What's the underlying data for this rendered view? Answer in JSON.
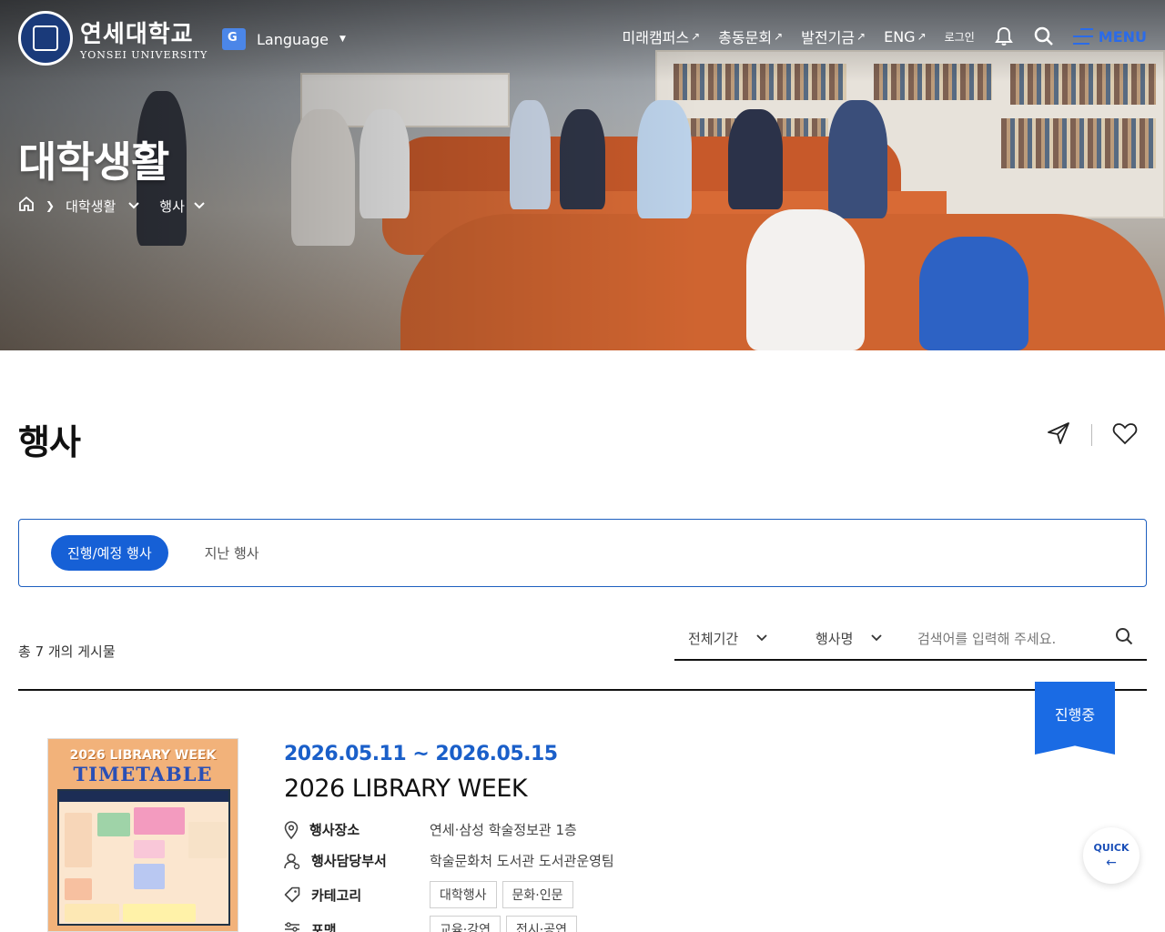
{
  "header": {
    "logo_ko": "연세대학교",
    "logo_en": "YONSEI UNIVERSITY",
    "language_label": "Language",
    "nav": [
      {
        "label": "미래캠퍼스",
        "arrow": "↗"
      },
      {
        "label": "총동문회",
        "arrow": "↗"
      },
      {
        "label": "발전기금",
        "arrow": "↗"
      },
      {
        "label": "ENG",
        "arrow": "↗"
      }
    ],
    "login_label": "로그인",
    "menu_label": "MENU"
  },
  "hero": {
    "title": "대학생활",
    "breadcrumb": [
      "대학생활",
      "행사"
    ]
  },
  "main": {
    "page_title": "행사",
    "tabs": [
      {
        "label": "진행/예정 행사",
        "active": true
      },
      {
        "label": "지난 행사",
        "active": false
      }
    ],
    "count_text": "총 7 개의 게시물",
    "filter_period": "전체기간",
    "filter_kind": "행사명",
    "search_placeholder": "검색어를 입력해 주세요."
  },
  "event": {
    "date": "2026.05.11 ~ 2026.05.15",
    "title": "2026 LIBRARY WEEK",
    "status": "진행중",
    "poster_title1": "2026 LIBRARY WEEK",
    "poster_title2": "TIMETABLE",
    "place_label": "행사장소",
    "place_value": "연세·삼성 학술정보관 1층",
    "dept_label": "행사담당부서",
    "dept_value": "학술문화처 도서관 도서관운영팀",
    "category_label": "카테고리",
    "categories": [
      "대학행사",
      "문화·인문"
    ],
    "format_label": "포맷",
    "formats": [
      "교육·강연",
      "전시·공연"
    ]
  },
  "quick": {
    "label": "QUICK",
    "arrow": "←"
  },
  "colors": {
    "accent": "#1660d6",
    "tab_border": "#1e5fbf",
    "date_blue": "#1a5fc9"
  }
}
